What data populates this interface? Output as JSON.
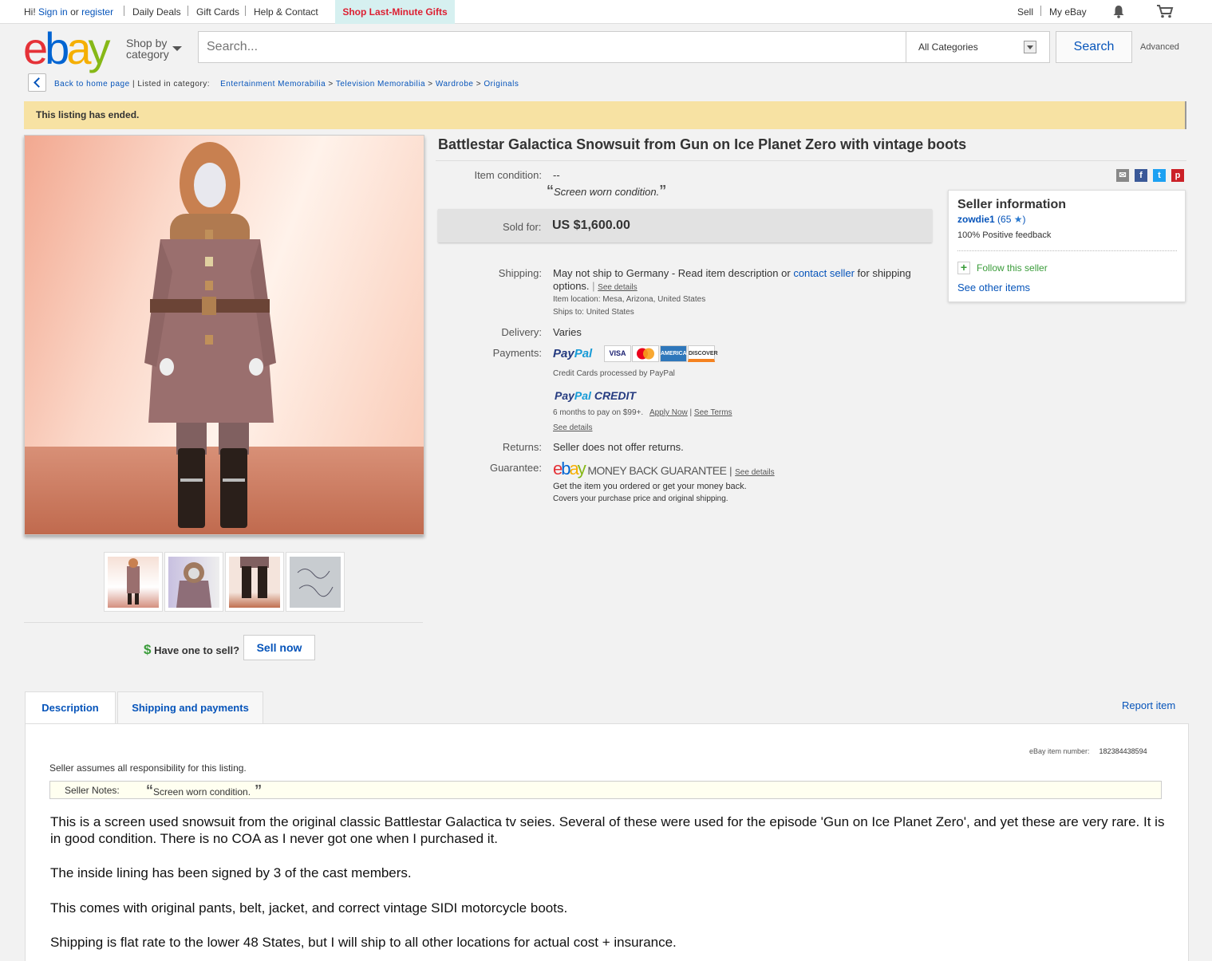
{
  "topbar": {
    "greeting": "Hi!",
    "sign_in": "Sign in",
    "or": "or",
    "register": "register",
    "daily_deals": "Daily Deals",
    "gift_cards": "Gift Cards",
    "help_contact": "Help & Contact",
    "promo": "Shop Last-Minute Gifts",
    "sell": "Sell",
    "my_ebay": "My eBay"
  },
  "header": {
    "shop_by_line1": "Shop by",
    "shop_by_line2": "category",
    "search_placeholder": "Search...",
    "category": "All Categories",
    "search_button": "Search",
    "advanced": "Advanced"
  },
  "breadcrumb": {
    "back": "Back to home page",
    "listed_in": "Listed in category:",
    "items": [
      "Entertainment Memorabilia",
      "Television Memorabilia",
      "Wardrobe",
      "Originals"
    ]
  },
  "banner": "This listing has ended.",
  "listing": {
    "title": "Battlestar Galactica Snowsuit from Gun on Ice Planet Zero with vintage boots",
    "condition_label": "Item condition:",
    "condition_value": "--",
    "condition_quote": "Screen worn condition.",
    "sold_label": "Sold for:",
    "price": "US $1,600.00",
    "shipping_label": "Shipping:",
    "shipping_text1": "May not ship to Germany - Read item description or",
    "contact_seller": "contact seller",
    "shipping_text2": "for shipping",
    "shipping_text3": "options.",
    "see_details": "See details",
    "item_location": "Item location:  Mesa, Arizona, United States",
    "ships_to": "Ships to:  United States",
    "delivery_label": "Delivery:",
    "delivery_value": "Varies",
    "payments_label": "Payments:",
    "paypal_a": "Pay",
    "paypal_b": "Pal",
    "cards": [
      "VISA",
      "MC",
      "AMEX",
      "DISCOVER"
    ],
    "credit_cards_note": "Credit Cards processed by PayPal",
    "paypal_credit": "CREDIT",
    "credit_terms": "6 months to pay on $99+.",
    "apply_now": "Apply Now",
    "see_terms": "See Terms",
    "returns_label": "Returns:",
    "returns_value": "Seller does not offer returns.",
    "guarantee_label": "Guarantee:",
    "guarantee_text": "MONEY BACK GUARANTEE",
    "guarantee_line1": "Get the item you ordered or get your money back.",
    "guarantee_line2": "Covers your purchase price and original shipping."
  },
  "seller": {
    "heading": "Seller information",
    "name": "zowdie1",
    "score": "(65",
    "score_close": ")",
    "feedback": "100% Positive feedback",
    "follow": "Follow this seller",
    "see_other": "See other items"
  },
  "sell_prompt": {
    "dollar": "$",
    "text": "Have one to sell?",
    "button": "Sell now"
  },
  "tabs": [
    "Description",
    "Shipping and payments"
  ],
  "report_item": "Report item",
  "description": {
    "item_number_label": "eBay item number:",
    "item_number": "182384438594",
    "responsibility": "Seller assumes all responsibility for this listing.",
    "notes_label": "Seller Notes:",
    "notes_quote": "Screen worn condition.",
    "paragraphs": [
      "This is a screen used snowsuit from the original classic Battlestar Galactica tv seies.  Several of these were used for the episode 'Gun on Ice Planet Zero', and yet these are very rare.  It is in good condition.  There is no COA as I never got one when I purchased it.",
      "The inside lining has been signed by 3 of the cast members.",
      "This comes with original pants, belt, jacket, and correct vintage SIDI motorcycle boots.",
      "Shipping is flat rate to the lower 48 States, but I will ship to all other locations for actual cost + insurance."
    ]
  },
  "colors": {
    "link": "#0654ba",
    "banner": "#f7e2a3",
    "promo_red": "#dd1e31"
  }
}
